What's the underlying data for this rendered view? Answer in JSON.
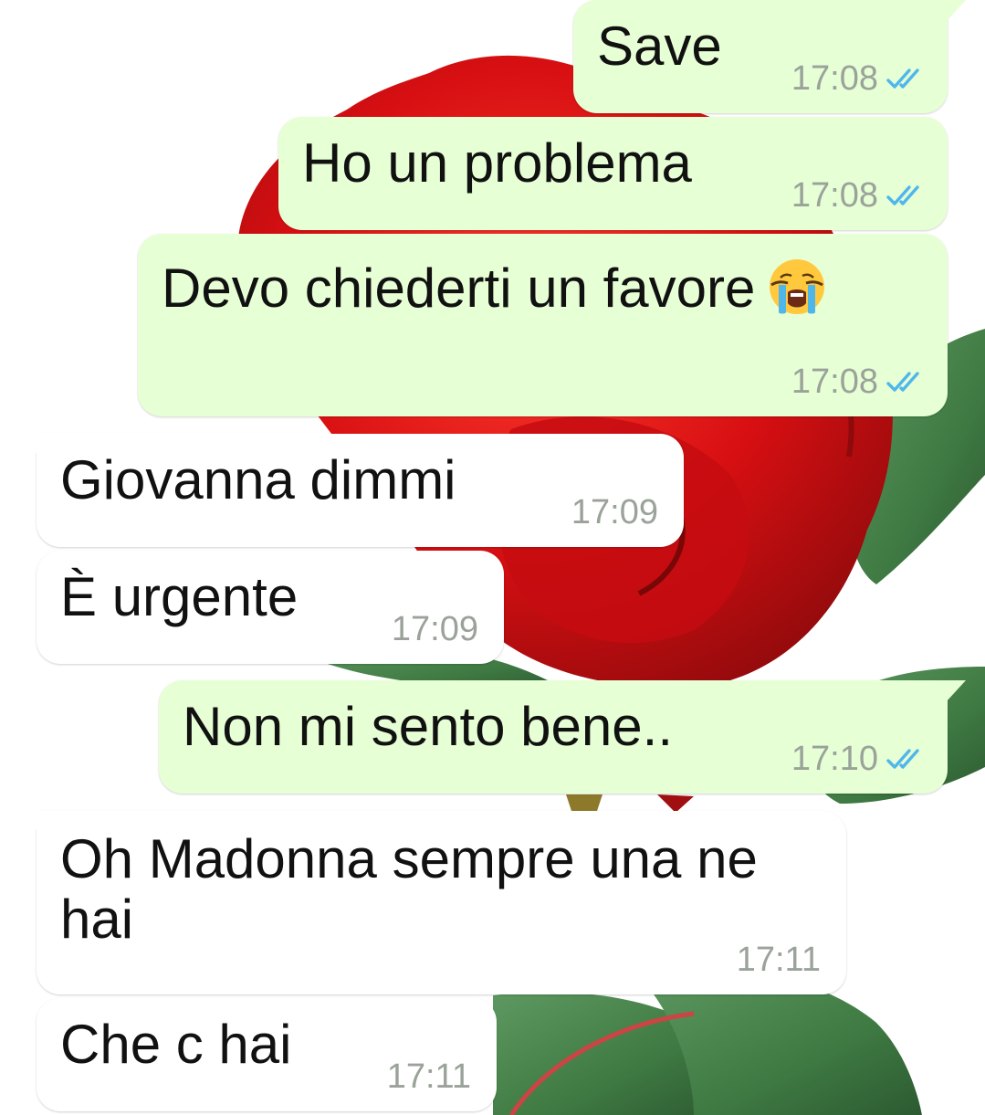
{
  "theme": {
    "outgoing_bubble": "#e6ffd5",
    "incoming_bubble": "#ffffff",
    "read_tick": "#4fb6ec",
    "time_color": "#9aa29a",
    "wallpaper_rose": "#d40f12",
    "wallpaper_leaf": "#3f7a43"
  },
  "messages": [
    {
      "direction": "outgoing",
      "text": "Save",
      "time": "17:08",
      "status": "read"
    },
    {
      "direction": "outgoing",
      "text": "Ho un problema",
      "time": "17:08",
      "status": "read"
    },
    {
      "direction": "outgoing",
      "text": "Devo chiederti un favore",
      "emoji": "loudly-crying-face",
      "time": "17:08",
      "status": "read"
    },
    {
      "direction": "incoming",
      "text": "Giovanna dimmi",
      "time": "17:09"
    },
    {
      "direction": "incoming",
      "text": "È urgente",
      "time": "17:09"
    },
    {
      "direction": "outgoing",
      "text": "Non mi sento bene..",
      "time": "17:10",
      "status": "read"
    },
    {
      "direction": "incoming",
      "text": "Oh Madonna sempre una ne hai",
      "time": "17:11"
    },
    {
      "direction": "incoming",
      "text": "Che c hai",
      "time": "17:11"
    }
  ]
}
